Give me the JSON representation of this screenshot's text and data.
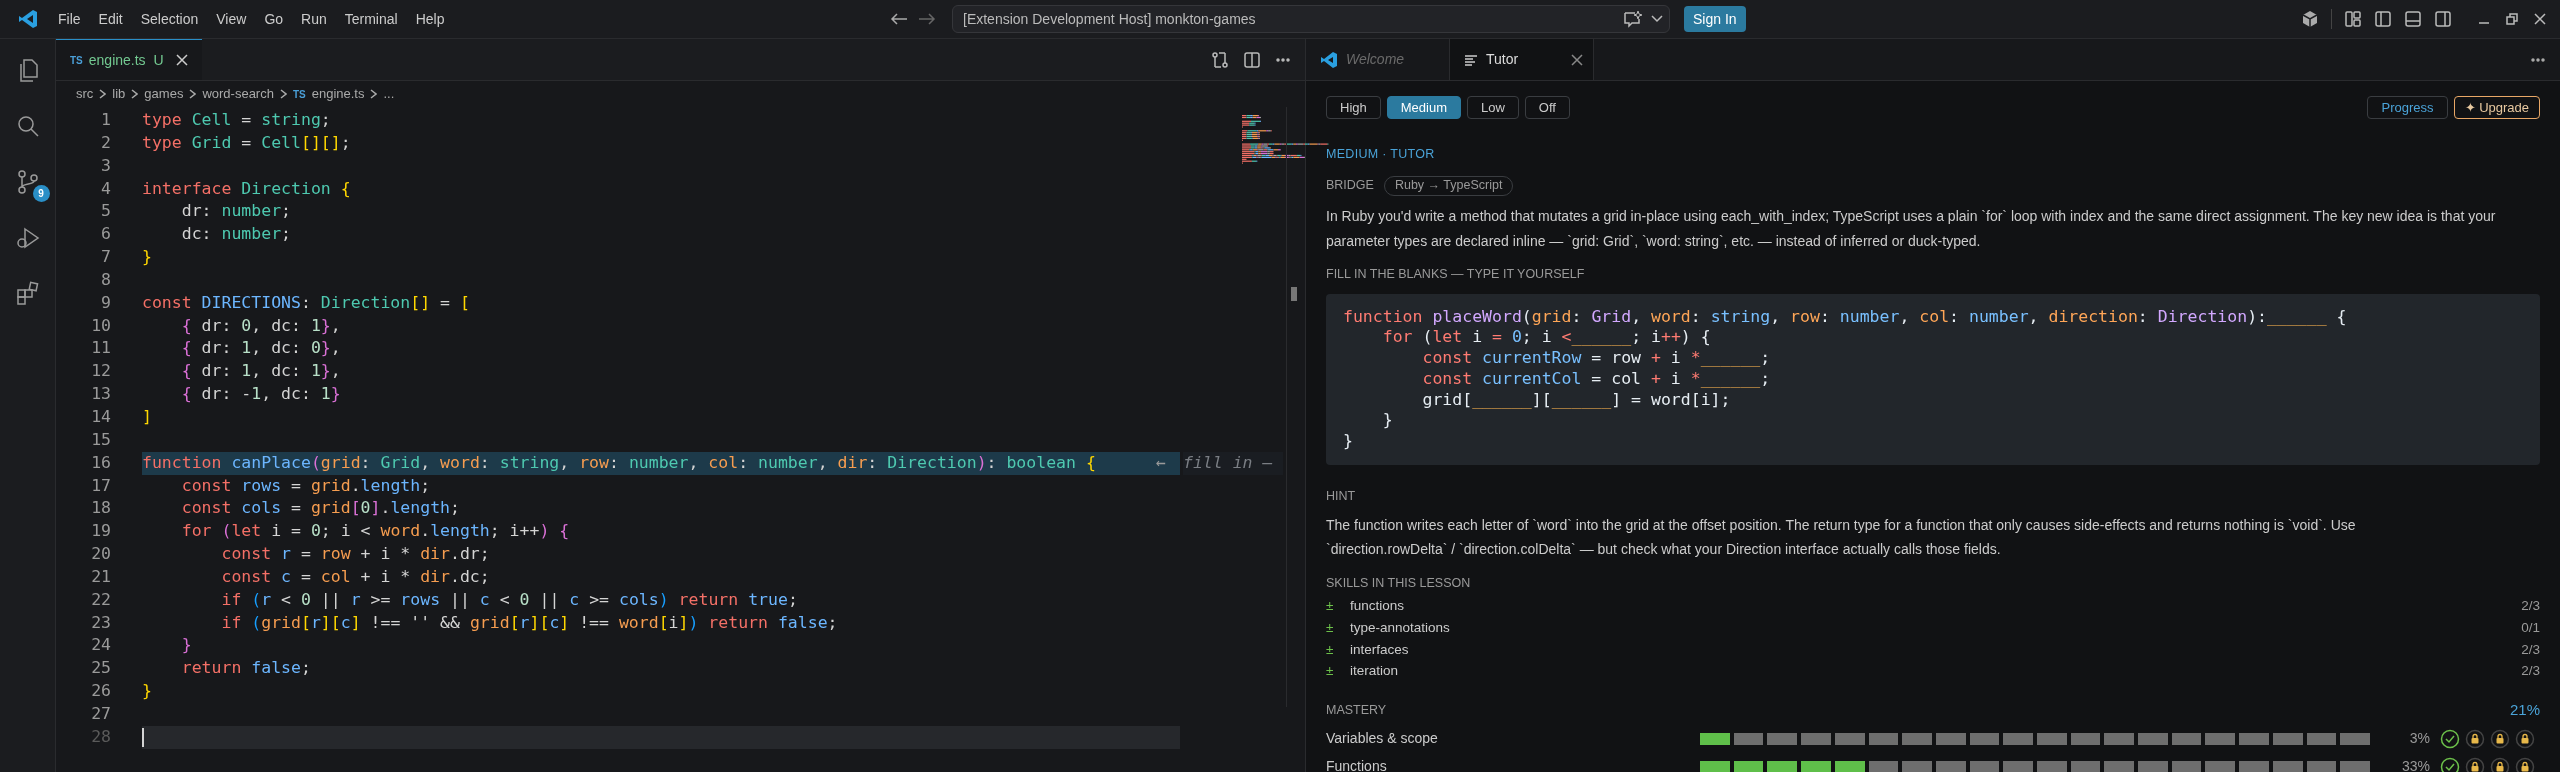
{
  "title_bar": {
    "menu": [
      "File",
      "Edit",
      "Selection",
      "View",
      "Go",
      "Run",
      "Terminal",
      "Help"
    ],
    "command_center": "[Extension Development Host] monkton-games",
    "sign_in": "Sign In"
  },
  "activity_bar": [
    {
      "kind": "files"
    },
    {
      "kind": "search"
    },
    {
      "kind": "source-control",
      "badge": "9"
    },
    {
      "kind": "run-debug"
    },
    {
      "kind": "extensions"
    }
  ],
  "editor": {
    "tabs": [
      {
        "icon": "TS",
        "label": "engine.ts",
        "status": "U",
        "selected": true
      }
    ],
    "breadcrumbs": [
      {
        "text": "src"
      },
      {
        "text": "lib"
      },
      {
        "text": "games"
      },
      {
        "text": "word-search"
      },
      {
        "icon": "TS",
        "text": "engine.ts"
      },
      {
        "text": "..."
      }
    ],
    "lines": [
      {
        "n": "1",
        "highlighted": false,
        "cursor": false,
        "tokens": [
          {
            "kind": "keyword",
            "text": "type "
          },
          {
            "kind": "type",
            "text": "Cell"
          },
          {
            "kind": "plain",
            "text": " = "
          },
          {
            "kind": "type",
            "text": "string"
          },
          {
            "kind": "plain",
            "text": ";"
          }
        ]
      },
      {
        "n": "2",
        "highlighted": false,
        "cursor": false,
        "tokens": [
          {
            "kind": "keyword",
            "text": "type "
          },
          {
            "kind": "type",
            "text": "Grid"
          },
          {
            "kind": "plain",
            "text": " = "
          },
          {
            "kind": "type",
            "text": "Cell"
          },
          {
            "kind": "bracket1",
            "text": "[][]"
          },
          {
            "kind": "plain",
            "text": ";"
          }
        ]
      },
      {
        "n": "3",
        "highlighted": false,
        "cursor": false
      },
      {
        "n": "4",
        "highlighted": false,
        "cursor": false,
        "tokens": [
          {
            "kind": "keyword",
            "text": "interface "
          },
          {
            "kind": "type",
            "text": "Direction "
          },
          {
            "kind": "bracket1",
            "text": "{"
          }
        ]
      },
      {
        "n": "5",
        "highlighted": false,
        "cursor": false,
        "tokens": [
          {
            "kind": "plain",
            "text": "    dr: "
          },
          {
            "kind": "type",
            "text": "number"
          },
          {
            "kind": "plain",
            "text": ";"
          }
        ]
      },
      {
        "n": "6",
        "highlighted": false,
        "cursor": false,
        "tokens": [
          {
            "kind": "plain",
            "text": "    dc: "
          },
          {
            "kind": "type",
            "text": "number"
          },
          {
            "kind": "plain",
            "text": ";"
          }
        ]
      },
      {
        "n": "7",
        "highlighted": false,
        "cursor": false,
        "tokens": [
          {
            "kind": "bracket1",
            "text": "}"
          }
        ]
      },
      {
        "n": "8",
        "highlighted": false,
        "cursor": false
      },
      {
        "n": "9",
        "highlighted": false,
        "cursor": false,
        "tokens": [
          {
            "kind": "keyword",
            "text": "const "
          },
          {
            "kind": "variable",
            "text": "DIRECTIONS"
          },
          {
            "kind": "plain",
            "text": ": "
          },
          {
            "kind": "type",
            "text": "Direction"
          },
          {
            "kind": "bracket1",
            "text": "[]"
          },
          {
            "kind": "plain",
            "text": " = "
          },
          {
            "kind": "bracket1",
            "text": "["
          }
        ]
      },
      {
        "n": "10",
        "highlighted": false,
        "cursor": false,
        "tokens": [
          {
            "kind": "bracket2",
            "text": "    {"
          },
          {
            "kind": "plain",
            "text": " dr: "
          },
          {
            "kind": "number",
            "text": "0"
          },
          {
            "kind": "plain",
            "text": ", dc: "
          },
          {
            "kind": "number",
            "text": "1"
          },
          {
            "kind": "bracket2",
            "text": "}"
          },
          {
            "kind": "plain",
            "text": ","
          }
        ]
      },
      {
        "n": "11",
        "highlighted": false,
        "cursor": false,
        "tokens": [
          {
            "kind": "bracket2",
            "text": "    {"
          },
          {
            "kind": "plain",
            "text": " dr: "
          },
          {
            "kind": "number",
            "text": "1"
          },
          {
            "kind": "plain",
            "text": ", dc: "
          },
          {
            "kind": "number",
            "text": "0"
          },
          {
            "kind": "bracket2",
            "text": "}"
          },
          {
            "kind": "plain",
            "text": ","
          }
        ]
      },
      {
        "n": "12",
        "highlighted": false,
        "cursor": false,
        "tokens": [
          {
            "kind": "bracket2",
            "text": "    {"
          },
          {
            "kind": "plain",
            "text": " dr: "
          },
          {
            "kind": "number",
            "text": "1"
          },
          {
            "kind": "plain",
            "text": ", dc: "
          },
          {
            "kind": "number",
            "text": "1"
          },
          {
            "kind": "bracket2",
            "text": "}"
          },
          {
            "kind": "plain",
            "text": ","
          }
        ]
      },
      {
        "n": "13",
        "highlighted": false,
        "cursor": false,
        "tokens": [
          {
            "kind": "bracket2",
            "text": "    {"
          },
          {
            "kind": "plain",
            "text": " dr: -"
          },
          {
            "kind": "number",
            "text": "1"
          },
          {
            "kind": "plain",
            "text": ", dc: "
          },
          {
            "kind": "number",
            "text": "1"
          },
          {
            "kind": "bracket2",
            "text": "}"
          }
        ]
      },
      {
        "n": "14",
        "highlighted": false,
        "cursor": false,
        "tokens": [
          {
            "kind": "bracket1",
            "text": "]"
          }
        ]
      },
      {
        "n": "15",
        "highlighted": false,
        "cursor": false
      },
      {
        "n": "16",
        "highlighted": true,
        "cursor": false,
        "tokens": [
          {
            "kind": "keyword",
            "text": "function "
          },
          {
            "kind": "function",
            "text": "canPlace"
          },
          {
            "kind": "bracket2",
            "text": "("
          },
          {
            "kind": "param",
            "text": "grid"
          },
          {
            "kind": "plain",
            "text": ": "
          },
          {
            "kind": "type",
            "text": "Grid"
          },
          {
            "kind": "plain",
            "text": ", "
          },
          {
            "kind": "param",
            "text": "word"
          },
          {
            "kind": "plain",
            "text": ": "
          },
          {
            "kind": "type",
            "text": "string"
          },
          {
            "kind": "plain",
            "text": ", "
          },
          {
            "kind": "param",
            "text": "row"
          },
          {
            "kind": "plain",
            "text": ": "
          },
          {
            "kind": "type",
            "text": "number"
          },
          {
            "kind": "plain",
            "text": ", "
          },
          {
            "kind": "param",
            "text": "col"
          },
          {
            "kind": "plain",
            "text": ": "
          },
          {
            "kind": "type",
            "text": "number"
          },
          {
            "kind": "plain",
            "text": ", "
          },
          {
            "kind": "param",
            "text": "dir"
          },
          {
            "kind": "plain",
            "text": ": "
          },
          {
            "kind": "type",
            "text": "Direction"
          },
          {
            "kind": "bracket2",
            "text": ")"
          },
          {
            "kind": "plain",
            "text": ": "
          },
          {
            "kind": "type",
            "text": "boolean "
          },
          {
            "kind": "bracket1",
            "text": "{"
          }
        ],
        "ghost": {
          "arrow": "←",
          "text": "fill in —"
        }
      },
      {
        "n": "17",
        "highlighted": false,
        "cursor": false,
        "tokens": [
          {
            "kind": "keyword",
            "text": "    const "
          },
          {
            "kind": "variable",
            "text": "rows"
          },
          {
            "kind": "plain",
            "text": " = "
          },
          {
            "kind": "param",
            "text": "grid"
          },
          {
            "kind": "plain",
            "text": "."
          },
          {
            "kind": "variable",
            "text": "length"
          },
          {
            "kind": "plain",
            "text": ";"
          }
        ]
      },
      {
        "n": "18",
        "highlighted": false,
        "cursor": false,
        "tokens": [
          {
            "kind": "keyword",
            "text": "    const "
          },
          {
            "kind": "variable",
            "text": "cols"
          },
          {
            "kind": "plain",
            "text": " = "
          },
          {
            "kind": "param",
            "text": "grid"
          },
          {
            "kind": "bracket2",
            "text": "["
          },
          {
            "kind": "number",
            "text": "0"
          },
          {
            "kind": "bracket2",
            "text": "]"
          },
          {
            "kind": "plain",
            "text": "."
          },
          {
            "kind": "variable",
            "text": "length"
          },
          {
            "kind": "plain",
            "text": ";"
          }
        ]
      },
      {
        "n": "19",
        "highlighted": false,
        "cursor": false,
        "tokens": [
          {
            "kind": "keyword",
            "text": "    for "
          },
          {
            "kind": "bracket2",
            "text": "("
          },
          {
            "kind": "keyword",
            "text": "let"
          },
          {
            "kind": "plain",
            "text": " i = "
          },
          {
            "kind": "number",
            "text": "0"
          },
          {
            "kind": "plain",
            "text": "; i < "
          },
          {
            "kind": "param",
            "text": "word"
          },
          {
            "kind": "plain",
            "text": "."
          },
          {
            "kind": "variable",
            "text": "length"
          },
          {
            "kind": "plain",
            "text": "; i++"
          },
          {
            "kind": "bracket2",
            "text": ") {"
          }
        ]
      },
      {
        "n": "20",
        "highlighted": false,
        "cursor": false,
        "tokens": [
          {
            "kind": "keyword",
            "text": "        const "
          },
          {
            "kind": "variable",
            "text": "r"
          },
          {
            "kind": "plain",
            "text": " = "
          },
          {
            "kind": "param",
            "text": "row"
          },
          {
            "kind": "plain",
            "text": " + i * "
          },
          {
            "kind": "param",
            "text": "dir"
          },
          {
            "kind": "plain",
            "text": ".dr;"
          }
        ]
      },
      {
        "n": "21",
        "highlighted": false,
        "cursor": false,
        "tokens": [
          {
            "kind": "keyword",
            "text": "        const "
          },
          {
            "kind": "variable",
            "text": "c"
          },
          {
            "kind": "plain",
            "text": " = "
          },
          {
            "kind": "param",
            "text": "col"
          },
          {
            "kind": "plain",
            "text": " + i * "
          },
          {
            "kind": "param",
            "text": "dir"
          },
          {
            "kind": "plain",
            "text": ".dc;"
          }
        ]
      },
      {
        "n": "22",
        "highlighted": false,
        "cursor": false,
        "tokens": [
          {
            "kind": "keyword",
            "text": "        if "
          },
          {
            "kind": "bracket3",
            "text": "("
          },
          {
            "kind": "variable",
            "text": "r"
          },
          {
            "kind": "plain",
            "text": " < "
          },
          {
            "kind": "number",
            "text": "0"
          },
          {
            "kind": "plain",
            "text": " || "
          },
          {
            "kind": "variable",
            "text": "r"
          },
          {
            "kind": "plain",
            "text": " >= "
          },
          {
            "kind": "variable",
            "text": "rows"
          },
          {
            "kind": "plain",
            "text": " || "
          },
          {
            "kind": "variable",
            "text": "c"
          },
          {
            "kind": "plain",
            "text": " < "
          },
          {
            "kind": "number",
            "text": "0"
          },
          {
            "kind": "plain",
            "text": " || "
          },
          {
            "kind": "variable",
            "text": "c"
          },
          {
            "kind": "plain",
            "text": " >= "
          },
          {
            "kind": "variable",
            "text": "cols"
          },
          {
            "kind": "bracket3",
            "text": ") "
          },
          {
            "kind": "keyword",
            "text": "return "
          },
          {
            "kind": "variable",
            "text": "true"
          },
          {
            "kind": "plain",
            "text": ";"
          }
        ]
      },
      {
        "n": "23",
        "highlighted": false,
        "cursor": false,
        "tokens": [
          {
            "kind": "keyword",
            "text": "        if "
          },
          {
            "kind": "bracket3",
            "text": "("
          },
          {
            "kind": "param",
            "text": "grid"
          },
          {
            "kind": "bracket1",
            "text": "["
          },
          {
            "kind": "variable",
            "text": "r"
          },
          {
            "kind": "bracket1",
            "text": "]["
          },
          {
            "kind": "variable",
            "text": "c"
          },
          {
            "kind": "bracket1",
            "text": "]"
          },
          {
            "kind": "plain",
            "text": " !== '' && "
          },
          {
            "kind": "param",
            "text": "grid"
          },
          {
            "kind": "bracket1",
            "text": "["
          },
          {
            "kind": "variable",
            "text": "r"
          },
          {
            "kind": "bracket1",
            "text": "]["
          },
          {
            "kind": "variable",
            "text": "c"
          },
          {
            "kind": "bracket1",
            "text": "]"
          },
          {
            "kind": "plain",
            "text": " !== "
          },
          {
            "kind": "param",
            "text": "word"
          },
          {
            "kind": "bracket1",
            "text": "["
          },
          {
            "kind": "plain",
            "text": "i"
          },
          {
            "kind": "bracket1",
            "text": "]"
          },
          {
            "kind": "bracket3",
            "text": ") "
          },
          {
            "kind": "keyword",
            "text": "return "
          },
          {
            "kind": "variable",
            "text": "false"
          },
          {
            "kind": "plain",
            "text": ";"
          }
        ]
      },
      {
        "n": "24",
        "highlighted": false,
        "cursor": false,
        "tokens": [
          {
            "kind": "bracket2",
            "text": "    }"
          }
        ]
      },
      {
        "n": "25",
        "highlighted": false,
        "cursor": false,
        "tokens": [
          {
            "kind": "keyword",
            "text": "    return "
          },
          {
            "kind": "variable",
            "text": "false"
          },
          {
            "kind": "plain",
            "text": ";"
          }
        ]
      },
      {
        "n": "26",
        "highlighted": false,
        "cursor": false,
        "tokens": [
          {
            "kind": "bracket1",
            "text": "}"
          }
        ]
      },
      {
        "n": "27",
        "highlighted": false,
        "cursor": false
      },
      {
        "n": "28",
        "highlighted": false,
        "cursor": true
      }
    ]
  },
  "tutor": {
    "tabs": [
      {
        "kind": "welcome",
        "label": "Welcome",
        "selected": false
      },
      {
        "kind": "tutor",
        "label": "Tutor",
        "selected": true
      }
    ],
    "levels": [
      {
        "label": "High",
        "selected": false
      },
      {
        "label": "Medium",
        "selected": true
      },
      {
        "label": "Low",
        "selected": false
      },
      {
        "label": "Off",
        "selected": false
      }
    ],
    "progress": "Progress",
    "upgrade": "✦ Upgrade",
    "mode": "MEDIUM · TUTOR",
    "bridge": {
      "label": "BRIDGE",
      "tag": "Ruby → TypeScript",
      "text": "In Ruby you'd write a method that mutates a grid in-place using each_with_index; TypeScript uses a plain `for` loop with index and the same direct assignment. The key new idea is that your parameter types are declared inline — `grid: Grid`, `word: string`, etc. — instead of inferred or duck-typed."
    },
    "exercise_title": "FILL IN THE BLANKS — TYPE IT YOURSELF",
    "exercise_lines": [
      [
        {
          "kind": "keyword",
          "text": "function "
        },
        {
          "kind": "function",
          "text": "placeWord"
        },
        {
          "kind": "plain",
          "text": "("
        },
        {
          "kind": "param",
          "text": "grid"
        },
        {
          "kind": "plain",
          "text": ": "
        },
        {
          "kind": "class",
          "text": "Grid"
        },
        {
          "kind": "plain",
          "text": ", "
        },
        {
          "kind": "param",
          "text": "word"
        },
        {
          "kind": "plain",
          "text": ": "
        },
        {
          "kind": "type",
          "text": "string"
        },
        {
          "kind": "plain",
          "text": ", "
        },
        {
          "kind": "param",
          "text": "row"
        },
        {
          "kind": "plain",
          "text": ": "
        },
        {
          "kind": "type",
          "text": "number"
        },
        {
          "kind": "plain",
          "text": ", "
        },
        {
          "kind": "param",
          "text": "col"
        },
        {
          "kind": "plain",
          "text": ": "
        },
        {
          "kind": "type",
          "text": "number"
        },
        {
          "kind": "plain",
          "text": ", "
        },
        {
          "kind": "param",
          "text": "direction"
        },
        {
          "kind": "plain",
          "text": ": "
        },
        {
          "kind": "class",
          "text": "Direction"
        },
        {
          "kind": "plain",
          "text": "):"
        },
        {
          "kind": "blank",
          "text": "______"
        },
        {
          "kind": "plain",
          "text": " {"
        }
      ],
      [
        {
          "kind": "keyword",
          "text": "    for"
        },
        {
          "kind": "plain",
          "text": " ("
        },
        {
          "kind": "keyword",
          "text": "let"
        },
        {
          "kind": "plain",
          "text": " i "
        },
        {
          "kind": "keyword",
          "text": "="
        },
        {
          "kind": "type",
          "text": " 0"
        },
        {
          "kind": "plain",
          "text": "; i "
        },
        {
          "kind": "keyword",
          "text": "<"
        },
        {
          "kind": "blank",
          "text": "______"
        },
        {
          "kind": "plain",
          "text": "; i"
        },
        {
          "kind": "keyword",
          "text": "++"
        },
        {
          "kind": "plain",
          "text": ") {"
        }
      ],
      [
        {
          "kind": "keyword",
          "text": "        const "
        },
        {
          "kind": "type",
          "text": "currentRow"
        },
        {
          "kind": "plain",
          "text": " = row "
        },
        {
          "kind": "keyword",
          "text": "+"
        },
        {
          "kind": "plain",
          "text": " i "
        },
        {
          "kind": "keyword",
          "text": "*"
        },
        {
          "kind": "blank",
          "text": "______"
        },
        {
          "kind": "plain",
          "text": ";"
        }
      ],
      [
        {
          "kind": "keyword",
          "text": "        const "
        },
        {
          "kind": "type",
          "text": "currentCol"
        },
        {
          "kind": "plain",
          "text": " = col "
        },
        {
          "kind": "keyword",
          "text": "+"
        },
        {
          "kind": "plain",
          "text": " i "
        },
        {
          "kind": "keyword",
          "text": "*"
        },
        {
          "kind": "blank",
          "text": "______"
        },
        {
          "kind": "plain",
          "text": ";"
        }
      ],
      [
        {
          "kind": "plain",
          "text": "        grid["
        },
        {
          "kind": "blank",
          "text": "______"
        },
        {
          "kind": "plain",
          "text": "]["
        },
        {
          "kind": "blank",
          "text": "______"
        },
        {
          "kind": "plain",
          "text": "] = word[i];"
        }
      ],
      [
        {
          "kind": "plain",
          "text": "    }"
        }
      ],
      [
        {
          "kind": "plain",
          "text": "}"
        }
      ]
    ],
    "hint": {
      "label": "HINT",
      "text": "The function writes each letter of `word` into the grid at the offset position. The return type for a function that only causes side-effects and returns nothing is `void`. Use `direction.rowDelta` / `direction.colDelta` — but check what your Direction interface actually calls those fields."
    },
    "skills": {
      "title": "SKILLS IN THIS LESSON",
      "items": [
        {
          "icon": "±",
          "name": "functions",
          "count": "2/3"
        },
        {
          "icon": "±",
          "name": "type-annotations",
          "count": "0/1"
        },
        {
          "icon": "±",
          "name": "interfaces",
          "count": "2/3"
        },
        {
          "icon": "±",
          "name": "iteration",
          "count": "2/3"
        }
      ]
    },
    "mastery": {
      "title": "MASTERY",
      "total": "21%",
      "rows": [
        {
          "name": "Variables & scope",
          "level": 0.05,
          "percent": "3%",
          "badges": [
            {
              "kind": "check"
            },
            {
              "kind": "lock"
            },
            {
              "kind": "lock"
            },
            {
              "kind": "lock"
            }
          ]
        },
        {
          "name": "Functions",
          "level": 0.25,
          "percent": "33%",
          "badges": [
            {
              "kind": "check"
            },
            {
              "kind": "lock"
            },
            {
              "kind": "lock"
            },
            {
              "kind": "lock"
            }
          ]
        }
      ]
    }
  }
}
